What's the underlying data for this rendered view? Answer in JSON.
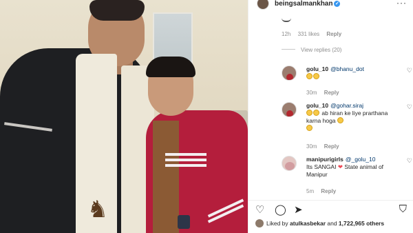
{
  "post": {
    "username": "beingsalmankhan",
    "verified_icon": "verified-badge-icon",
    "more_icon": "more-options-icon"
  },
  "top_comment_meta": {
    "time": "12h",
    "likes": "331 likes",
    "reply": "Reply"
  },
  "view_replies": "View replies (20)",
  "comments": [
    {
      "username": "golu_10",
      "mention": "@bhanu_dot",
      "text": "",
      "time": "30m",
      "reply": "Reply"
    },
    {
      "username": "golu_10",
      "mention": "@gohar.siraj",
      "text": "ab hiran ke liye prarthana karna hoga",
      "time": "30m",
      "reply": "Reply"
    },
    {
      "username": "manipurigirls",
      "mention": "@_golu_10",
      "text_a": "Its SANGAI",
      "text_b": "State animal of Manipur",
      "time": "5m",
      "reply": "Reply"
    }
  ],
  "actions": {
    "like_icon": "heart-icon",
    "comment_icon": "comment-icon",
    "share_icon": "share-icon",
    "save_icon": "bookmark-icon"
  },
  "likes_line": {
    "prefix": "Liked by ",
    "user": "atulkasbekar",
    "middle": " and ",
    "count": "1,722,965 others"
  },
  "colors": {
    "accent": "#3897f0",
    "heart": "#ed4956",
    "text": "#262626",
    "muted": "#8e8e8e"
  }
}
